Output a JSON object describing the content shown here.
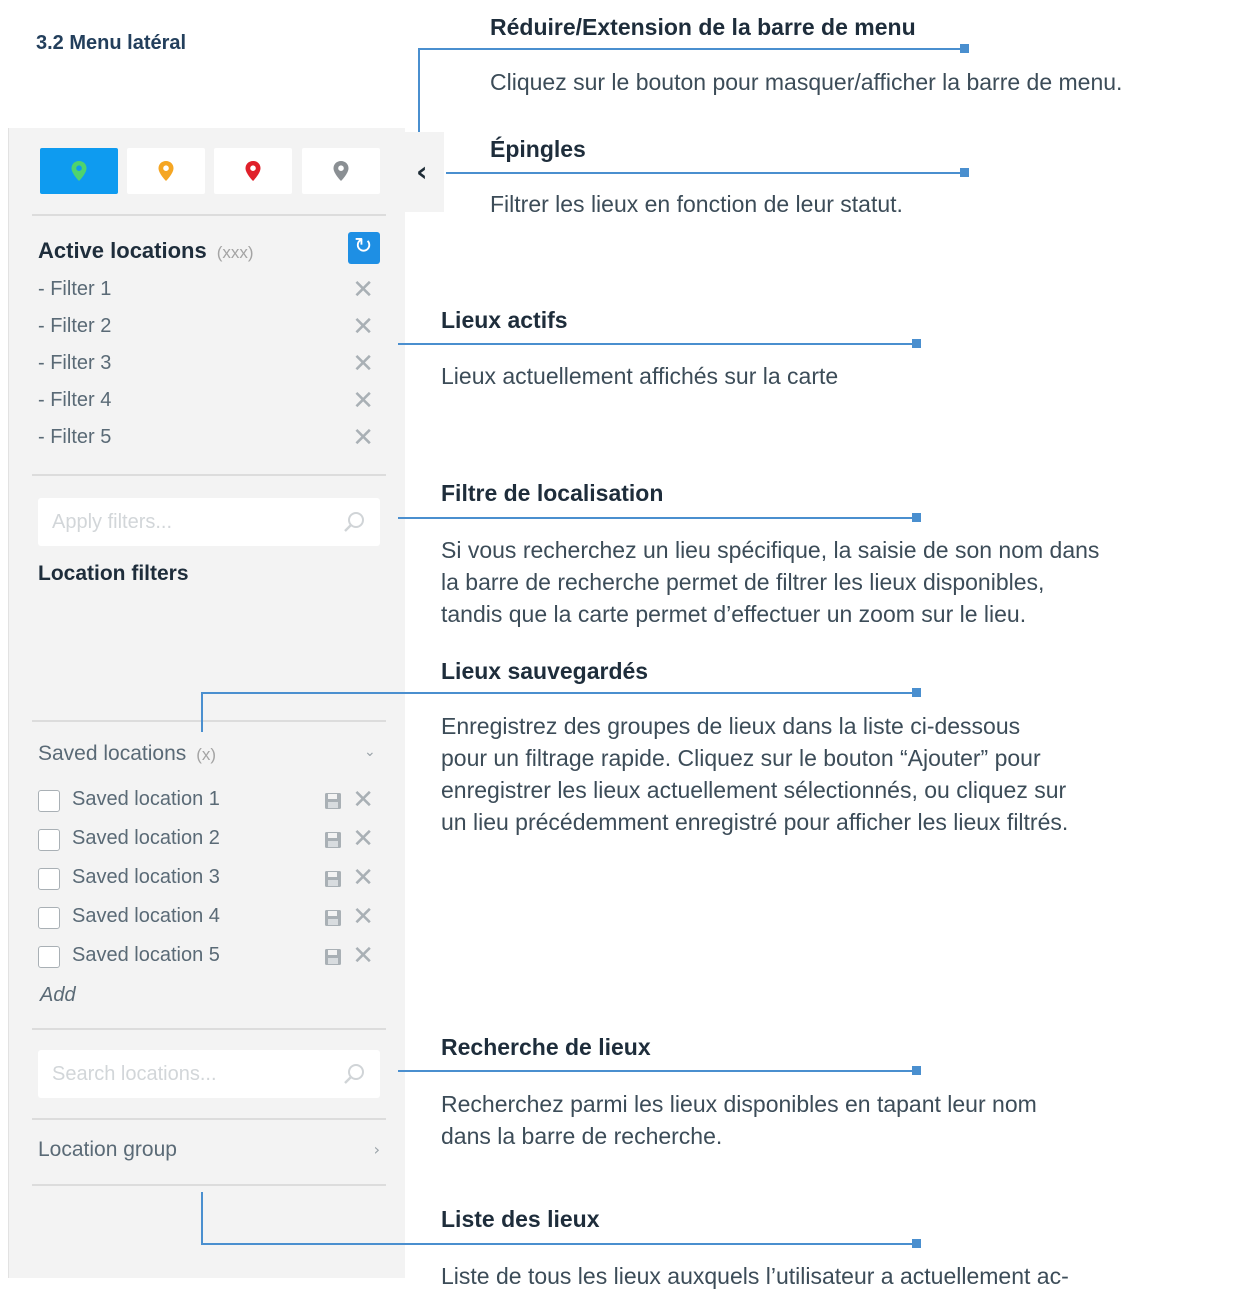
{
  "section_title": "3.2 Menu latéral",
  "sidebar": {
    "collapse_icon": "chevron-left-icon",
    "pins": [
      {
        "name": "green-pin-icon",
        "color": "#2ecc71",
        "active": true
      },
      {
        "name": "yellow-pin-icon",
        "color": "#f5a623",
        "active": false
      },
      {
        "name": "red-pin-icon",
        "color": "#e0202a",
        "active": false
      },
      {
        "name": "grey-pin-icon",
        "color": "#8a8f93",
        "active": false
      }
    ],
    "active_locations": {
      "title": "Active locations",
      "count": "(xxx)",
      "filters": [
        "- Filter 1",
        "- Filter 2",
        "- Filter 3",
        "- Filter 4",
        "- Filter 5"
      ]
    },
    "apply_filters_placeholder": "Apply filters...",
    "location_filters_label": "Location filters",
    "saved_locations": {
      "title": "Saved locations",
      "count": "(x)",
      "items": [
        "Saved location 1",
        "Saved location 2",
        "Saved location 3",
        "Saved location 4",
        "Saved location 5"
      ],
      "add_label": "Add"
    },
    "search_locations_placeholder": "Search locations...",
    "location_group_label": "Location group"
  },
  "annotations": {
    "collapse": {
      "title": "Réduire/Extension de la barre de menu",
      "text": "Cliquez sur le bouton pour masquer/afficher la barre de menu."
    },
    "pins": {
      "title": "Épingles",
      "text": "Filtrer les lieux en fonction de leur statut."
    },
    "active": {
      "title": "Lieux actifs",
      "text": "Lieux actuellement affichés sur la carte"
    },
    "location_filter": {
      "title": "Filtre de localisation",
      "lines": [
        "Si vous recherchez un lieu spécifique, la saisie de son nom dans",
        "la barre de recherche permet de filtrer les lieux disponibles,",
        "tandis que la carte permet d’effectuer un zoom sur le lieu."
      ]
    },
    "saved": {
      "title": "Lieux sauvegardés",
      "lines": [
        "Enregistrez des groupes de lieux dans la liste ci-dessous",
        "pour un filtrage rapide. Cliquez sur le bouton “Ajouter” pour",
        "enregistrer les lieux actuellement sélectionnés, ou cliquez sur",
        "un lieu précédemment enregistré pour afficher les lieux filtrés."
      ]
    },
    "search": {
      "title": "Recherche de lieux",
      "lines": [
        "Recherchez parmi les lieux disponibles en tapant leur nom",
        "dans la barre de recherche."
      ]
    },
    "list": {
      "title": "Liste des lieux",
      "text": "Liste de tous les lieux auxquels l’utilisateur a actuellement ac-"
    }
  }
}
